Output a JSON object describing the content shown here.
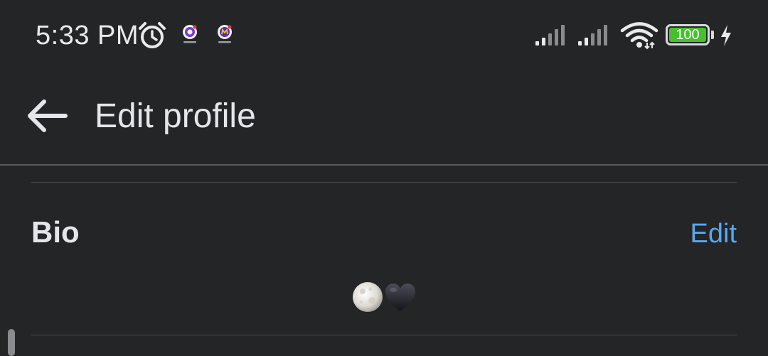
{
  "status_bar": {
    "time": "5:33 PM",
    "battery_level": "100",
    "battery_fraction": 1.0,
    "icons": [
      "alarm-icon",
      "notification-app-icon",
      "notification-app-icon",
      "signal-icon",
      "signal-icon",
      "wifi-icon",
      "battery-icon",
      "charging-icon"
    ]
  },
  "header": {
    "back_icon": "arrow-left-icon",
    "title": "Edit profile"
  },
  "bio_section": {
    "heading": "Bio",
    "edit_label": "Edit",
    "bio_emojis": [
      "full-moon-emoji",
      "black-heart-emoji"
    ]
  },
  "colors": {
    "background": "#242527",
    "text": "#e4e6eb",
    "link": "#5aa7f0",
    "battery_fill": "#46c02e",
    "divider": "#5b5c5f"
  }
}
